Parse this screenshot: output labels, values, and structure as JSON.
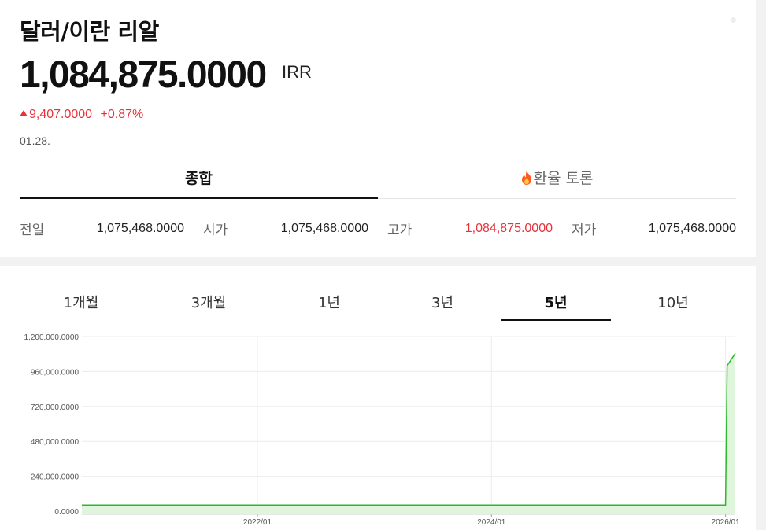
{
  "header": {
    "title": "달러/이란 리알",
    "price": "1,084,875.0000",
    "currency": "IRR",
    "change": "9,407.0000",
    "change_pct": "+0.87%",
    "date": "01.28."
  },
  "tabs": [
    {
      "label": "종합",
      "active": true
    },
    {
      "label": "환율 토론",
      "active": false,
      "icon": "fire-icon"
    }
  ],
  "quotes": [
    {
      "label": "전일",
      "value": "1,075,468.0000"
    },
    {
      "label": "시가",
      "value": "1,075,468.0000"
    },
    {
      "label": "고가",
      "value": "1,084,875.0000"
    },
    {
      "label": "저가",
      "value": "1,075,468.0000"
    }
  ],
  "periods": [
    {
      "label": "1개월"
    },
    {
      "label": "3개월"
    },
    {
      "label": "1년"
    },
    {
      "label": "3년"
    },
    {
      "label": "5년",
      "active": true
    },
    {
      "label": "10년"
    }
  ],
  "colors": {
    "up": "#e6333b",
    "line": "#2db82d",
    "fill": "#dff6dc"
  },
  "chart_data": {
    "type": "area",
    "y_tick_labels": [
      "1,200,000.0000",
      "960,000.0000",
      "720,000.0000",
      "480,000.0000",
      "240,000.0000",
      "0.0000"
    ],
    "y_ticks": [
      1200000,
      960000,
      720000,
      480000,
      240000,
      0
    ],
    "x_tick_labels": [
      "2022/01",
      "2024/01",
      "2026/01"
    ],
    "x_ticks": [
      "2022-01",
      "2024-01",
      "2026-01"
    ],
    "x_range": [
      "2020-07",
      "2026-02"
    ],
    "ylim": [
      0,
      1200000
    ],
    "grid": true,
    "series": [
      {
        "x": [
          "2020-07",
          "2022-01",
          "2024-01",
          "2025-12",
          "2026-01",
          "2026-01",
          "2026-02"
        ],
        "y": [
          42000,
          42000,
          42000,
          42000,
          42000,
          1000000,
          1084875
        ]
      }
    ]
  }
}
